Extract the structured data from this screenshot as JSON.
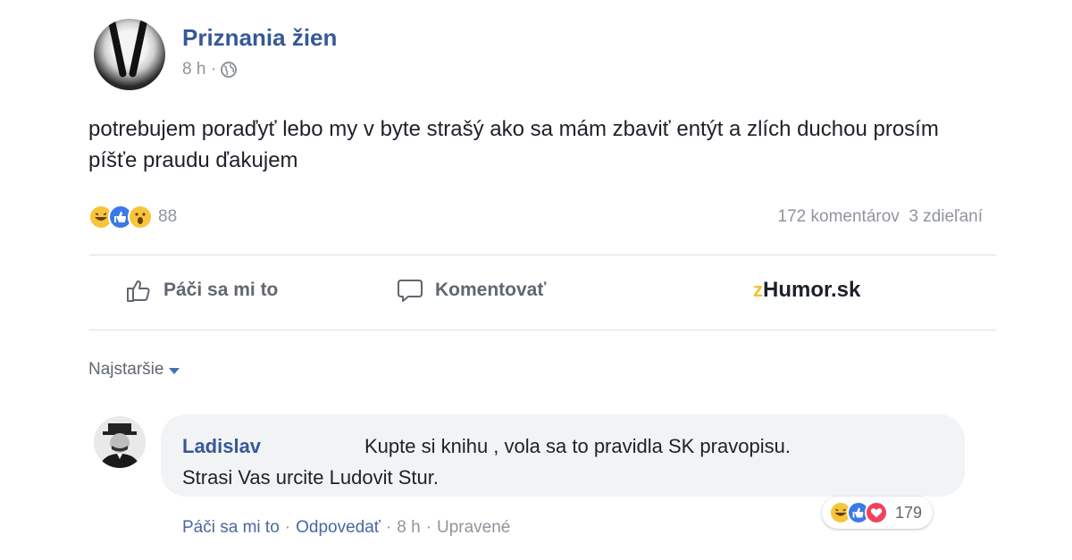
{
  "post": {
    "page_name": "Priznania žien",
    "time": "8 h ·",
    "text": "potrebujem poraďyť lebo my v byte strašý ako sa mám zbaviť entýt a zlích duchou prosím píšťe praudu ďakujem",
    "reaction_count": "88",
    "comments_count": "172 komentárov",
    "shares_count": "3 zdieľaní"
  },
  "actions": {
    "like_label": "Páči sa mi to",
    "comment_label": "Komentovať"
  },
  "brand": {
    "prefix": "z",
    "name": "Humor.sk",
    "accent": "#f2c12e"
  },
  "comments_sort": {
    "label": "Najstaršie"
  },
  "comment": {
    "author": "Ladislav",
    "text_line1": "Kupte si knihu , vola sa to pravidla SK pravopisu.",
    "text_line2": "Strasi Vas urcite Ludovit Stur.",
    "reaction_count": "179",
    "like_label": "Páči sa mi to",
    "reply_label": "Odpovedať",
    "time": "8 h",
    "edited_label": "Upravené"
  },
  "colors": {
    "link_blue": "#365899",
    "muted_gray": "#90949c",
    "bubble_bg": "#f2f3f5"
  }
}
